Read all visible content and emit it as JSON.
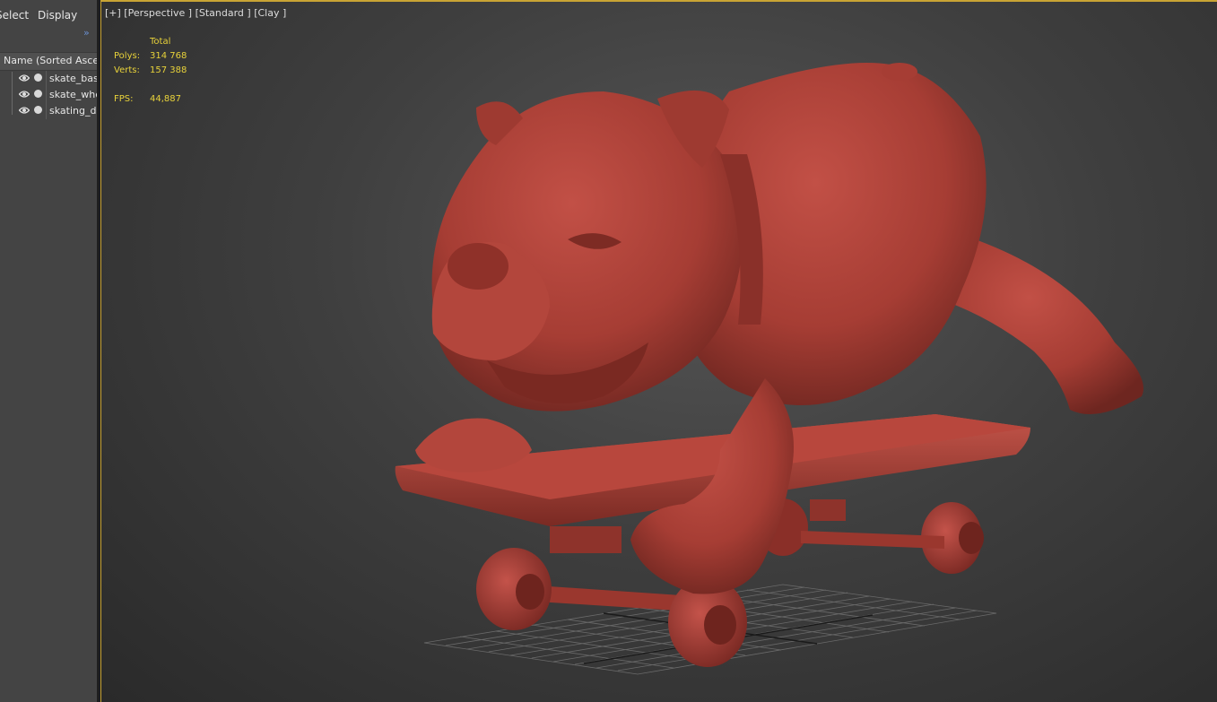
{
  "explorer": {
    "menu": {
      "select": "Select",
      "display": "Display"
    },
    "expand_chevron": "»",
    "column_header": "Name (Sorted Ascending)",
    "items": [
      {
        "label": "skate_base",
        "visible": true
      },
      {
        "label": "skate_wheels",
        "visible": true
      },
      {
        "label": "skating_dog",
        "visible": true
      }
    ]
  },
  "viewport": {
    "label": "[+] [Perspective ] [Standard ] [Clay ]",
    "stats": {
      "total_label": "Total",
      "polys_label": "Polys:",
      "polys_value": "314 768",
      "verts_label": "Verts:",
      "verts_value": "157 388",
      "fps_label": "FPS:",
      "fps_value": "44,887"
    },
    "model_description_icon": "clay-bulldog-on-skateboard",
    "colors": {
      "viewport_border": "#c9a434",
      "stats_text": "#e8d23a",
      "clay": "#b0443a"
    }
  }
}
